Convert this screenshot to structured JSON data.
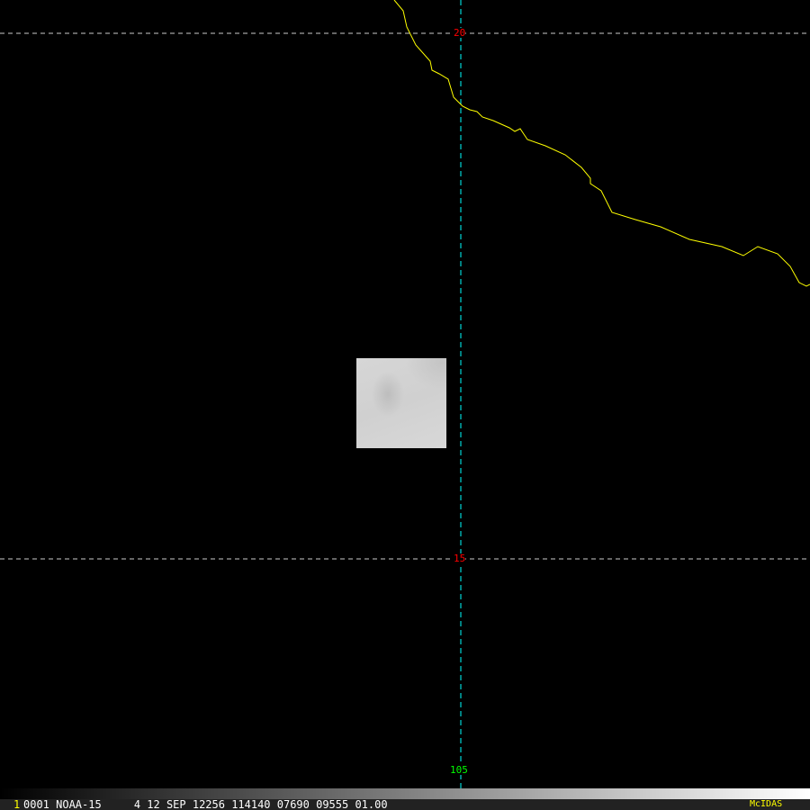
{
  "map": {
    "lat_labels": [
      "20",
      "15"
    ],
    "lon_labels": [
      "105"
    ],
    "colors": {
      "lat_grid": "#ffffff",
      "lat_label": "#ff0000",
      "lon_grid": "#00ffff",
      "lon_label": "#00ff00",
      "coastline": "#ffff00"
    }
  },
  "status_bar": {
    "frame_number": "1",
    "info": "0001 NOAA-15     4 12 SEP 12256 114140 07690 09555 01.00",
    "brand": "McIDAS"
  }
}
